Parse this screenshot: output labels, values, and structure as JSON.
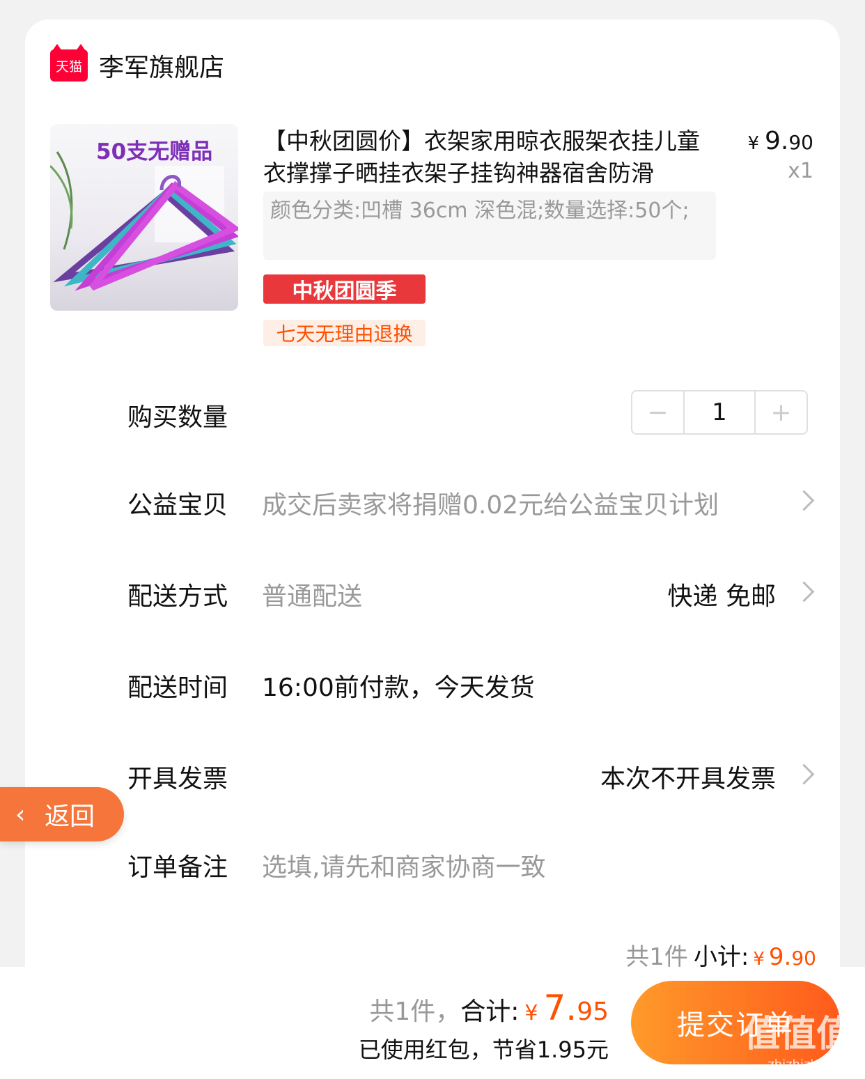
{
  "shop": {
    "logo_text": "天猫",
    "name": "李军旗舰店"
  },
  "product": {
    "image_caption": "50支无赠品",
    "title": "【中秋团圆价】衣架家用晾衣服架衣挂儿童衣撑撑子晒挂衣架子挂钩神器宿舍防滑",
    "price_currency": "¥",
    "price_int": "9.",
    "price_dec": "90",
    "quantity_label": "x1",
    "sku": "颜色分类:凹槽 36cm 深色混;数量选择:50个;",
    "promo_tag": "中秋团圆季",
    "return_tag": "七天无理由退换"
  },
  "rows": {
    "quantity": {
      "label": "购买数量",
      "minus": "−",
      "value": "1",
      "plus": "+"
    },
    "charity": {
      "label": "公益宝贝",
      "value": "成交后卖家将捐赠0.02元给公益宝贝计划"
    },
    "shipping": {
      "label": "配送方式",
      "value": "普通配送",
      "right": "快递 免邮"
    },
    "delivery_time": {
      "label": "配送时间",
      "value": "16:00前付款，今天发货"
    },
    "invoice": {
      "label": "开具发票",
      "right": "本次不开具发票"
    },
    "note": {
      "label": "订单备注",
      "placeholder": "选填,请先和商家协商一致"
    }
  },
  "back_button": {
    "arrow": "‹",
    "label": "返回"
  },
  "subtotal": {
    "count": "共1件",
    "label": "小计:",
    "currency": "¥",
    "int": "9.",
    "dec": "90"
  },
  "footer": {
    "count": "共1件，",
    "label": "合计:",
    "currency": "¥",
    "int": "7.",
    "dec": "95",
    "saved": "已使用红包，节省1.95元",
    "submit": "提交订单"
  },
  "watermark": {
    "text": "值值值",
    "url": "zhizhizhi.com"
  },
  "colors": {
    "accent": "#ff5000",
    "promo_red": "#e8383c",
    "back_orange": "#f5753a",
    "tmall_red": "#ff0036"
  }
}
